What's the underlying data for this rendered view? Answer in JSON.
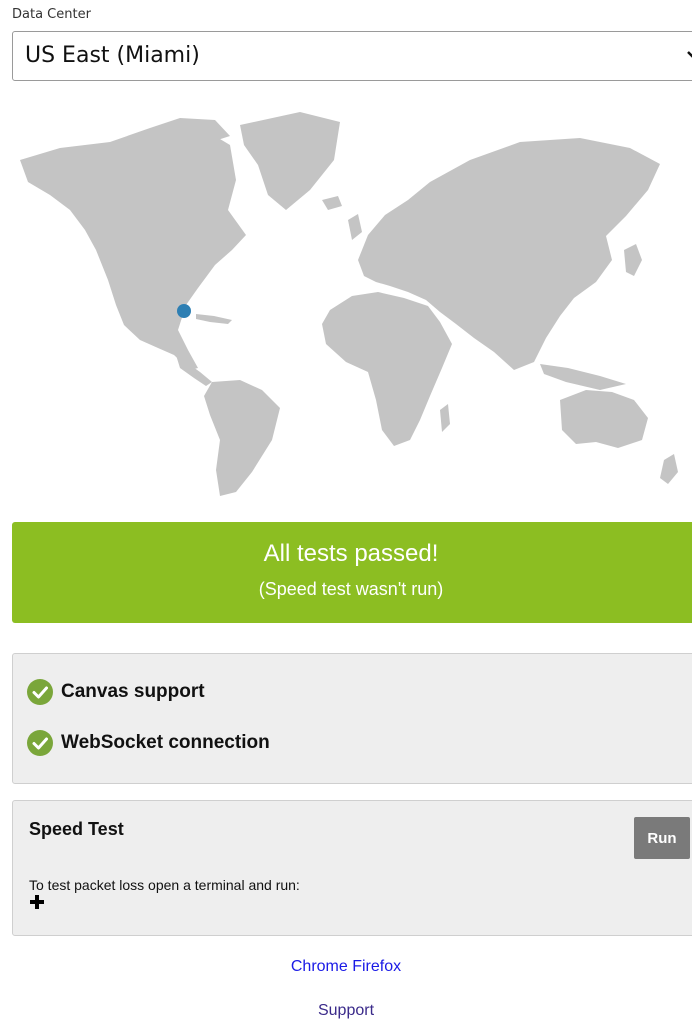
{
  "data_center": {
    "label": "Data Center",
    "selected": "US East (Miami)"
  },
  "status": {
    "title": "All tests passed!",
    "subtitle": "(Speed test wasn't run)",
    "color": "#8cbe22"
  },
  "checks": [
    {
      "label": "Canvas support",
      "status": "ok",
      "icon": "check-circle-icon"
    },
    {
      "label": "WebSocket connection",
      "status": "ok",
      "icon": "check-circle-icon"
    }
  ],
  "speed_test": {
    "title": "Speed Test",
    "run_label": "Run",
    "instruction": "To test packet loss open a terminal and run:",
    "expand_icon": "plus-icon"
  },
  "links": {
    "chrome": "Chrome",
    "firefox": "Firefox",
    "support": "Support"
  },
  "colors": {
    "land": "#c4c4c4",
    "marker": "#2e7fb3",
    "check": "#7aa63a",
    "panel": "#eeeeee"
  }
}
